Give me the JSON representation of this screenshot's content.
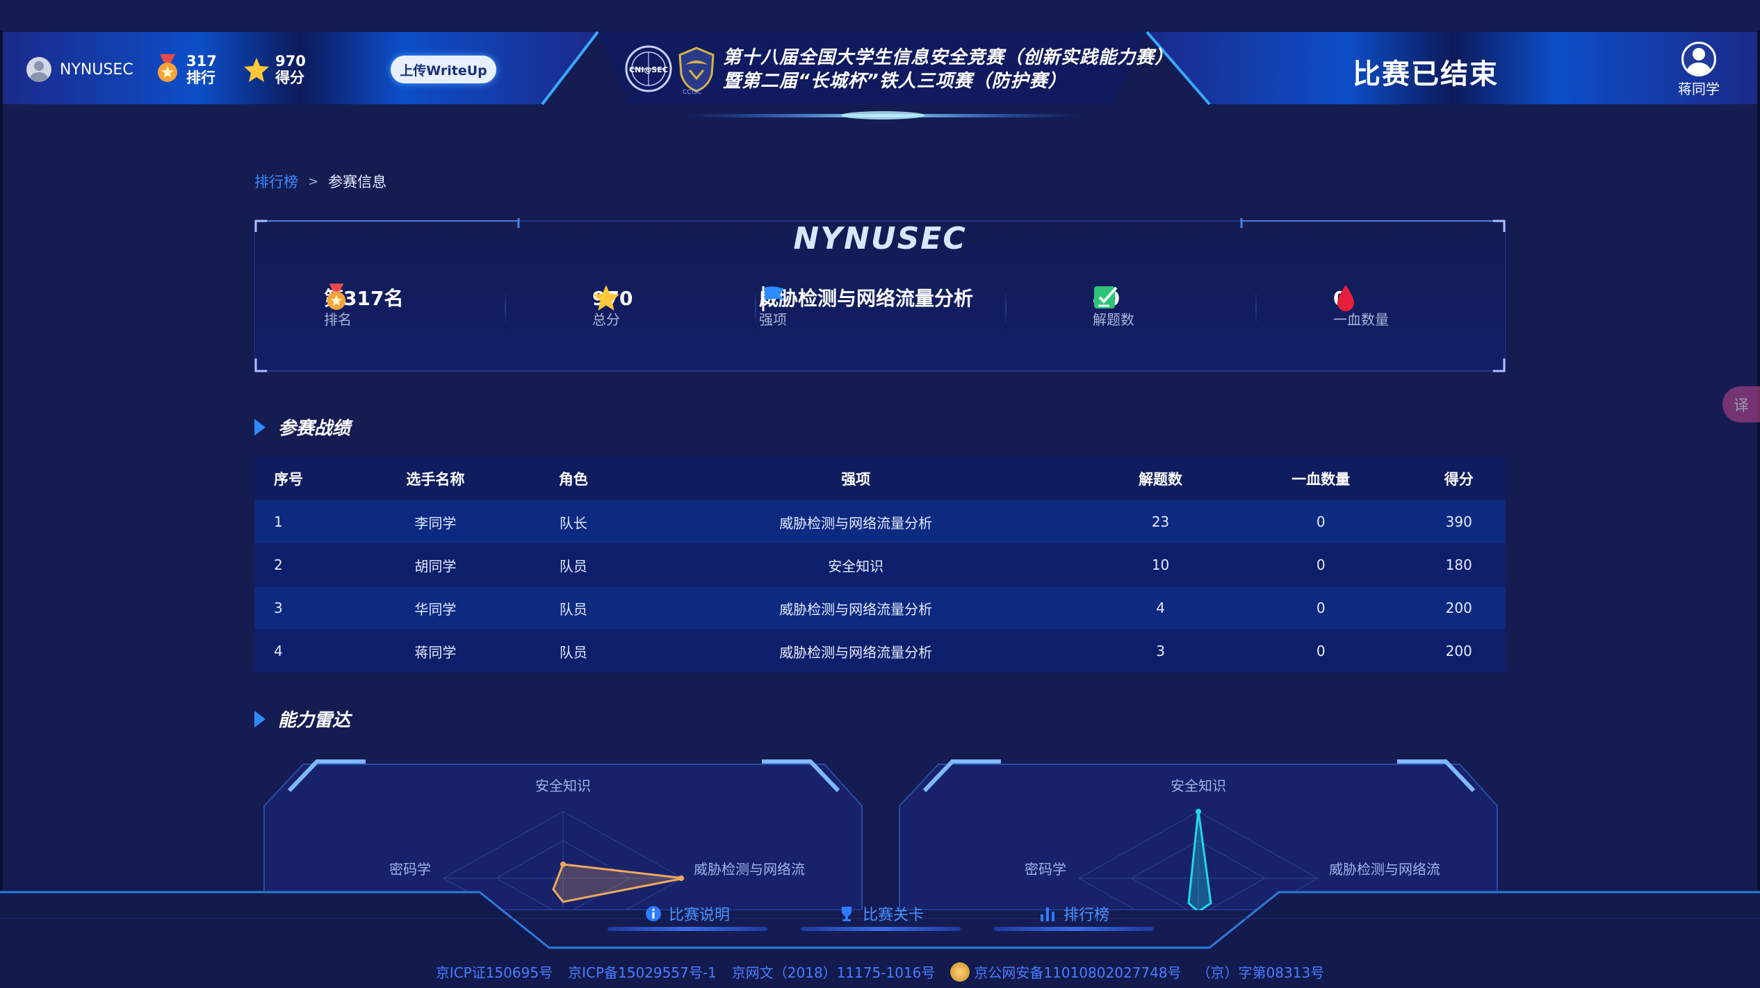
{
  "header": {
    "team": "NYNUSEC",
    "rank_value": "317",
    "rank_label": "排行",
    "score_value": "970",
    "score_label": "得分",
    "upload_label": "上传WriteUp",
    "title_line1": "第十八届全国大学生信息安全竞赛（创新实践能力赛）",
    "title_line2": "暨第二届“长城杯”铁人三项赛（防护赛）",
    "logo1_text": "CNI@SEC",
    "logo2_caption": "CCISC",
    "status": "比赛已结束",
    "user_name": "蒋同学"
  },
  "breadcrumb": {
    "link": "排行榜",
    "current": "参赛信息"
  },
  "team_card": {
    "name": "NYNUSEC",
    "stats": [
      {
        "icon": "medal-icon",
        "value": "第317名",
        "label": "排名"
      },
      {
        "icon": "star-icon",
        "value": "970",
        "label": "总分"
      },
      {
        "icon": "flag-icon",
        "value": "威胁检测与网络流量分析",
        "label": "强项"
      },
      {
        "icon": "solved-icon",
        "value": "40",
        "label": "解题数"
      },
      {
        "icon": "blood-drop-icon",
        "value": "0",
        "label": "一血数量"
      }
    ]
  },
  "sections": {
    "results": "参赛战绩",
    "radar": "能力雷达"
  },
  "table": {
    "headers": [
      "序号",
      "选手名称",
      "角色",
      "强项",
      "解题数",
      "一血数量",
      "得分"
    ],
    "rows": [
      [
        "1",
        "李同学",
        "队长",
        "威胁检测与网络流量分析",
        "23",
        "0",
        "390"
      ],
      [
        "2",
        "胡同学",
        "队员",
        "安全知识",
        "10",
        "0",
        "180"
      ],
      [
        "3",
        "华同学",
        "队员",
        "威胁检测与网络流量分析",
        "4",
        "0",
        "200"
      ],
      [
        "4",
        "蒋同学",
        "队员",
        "威胁检测与网络流量分析",
        "3",
        "0",
        "200"
      ]
    ]
  },
  "radars": [
    {
      "axis_top": "安全知识",
      "axis_left": "密码学",
      "axis_right": "威胁检测与网络流",
      "color": "#f0a860"
    },
    {
      "axis_top": "安全知识",
      "axis_left": "密码学",
      "axis_right": "威胁检测与网络流",
      "color": "#22d8e8"
    }
  ],
  "nav": [
    {
      "icon": "info-icon",
      "label": "比赛说明"
    },
    {
      "icon": "trophy-icon",
      "label": "比赛关卡"
    },
    {
      "icon": "bar-chart-icon",
      "label": "排行榜"
    }
  ],
  "footer": {
    "icp1": "京ICP证150695号",
    "icp2": "京ICP备15029557号-1",
    "culture": "京网文（2018）11175-1016号",
    "police": "京公网安备11010802027748号",
    "word": "（京）字第08313号"
  },
  "translate_label": "译",
  "colors": {
    "bg": "#141c52",
    "accent": "#2d8cff",
    "link": "#3f8bff"
  }
}
